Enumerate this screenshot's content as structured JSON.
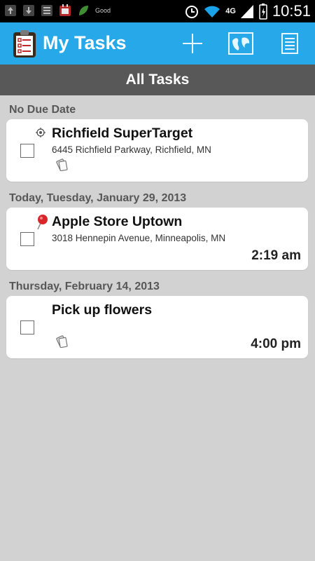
{
  "status_bar": {
    "time": "10:51",
    "network": "4G",
    "notification_good": "Good"
  },
  "action_bar": {
    "title": "My Tasks",
    "add_icon": "plus-icon",
    "map_icon": "map-icon",
    "list_icon": "list-icon"
  },
  "title_strip": "All Tasks",
  "sections": [
    {
      "header": "No Due Date",
      "task": {
        "title": "Richfield SuperTarget",
        "address": "6445 Richfield Parkway, Richfield, MN",
        "time": "",
        "location_icon": "location-target-icon",
        "note_icon": "note-icon"
      }
    },
    {
      "header": "Today, Tuesday, January 29, 2013",
      "task": {
        "title": "Apple Store Uptown",
        "address": "3018 Hennepin Avenue, Minneapolis, MN",
        "time": "2:19 am",
        "location_icon": "pin-icon"
      }
    },
    {
      "header": "Thursday, February 14, 2013",
      "task": {
        "title": "Pick up flowers",
        "address": "",
        "time": "4:00 pm",
        "note_icon": "note-icon"
      }
    }
  ]
}
